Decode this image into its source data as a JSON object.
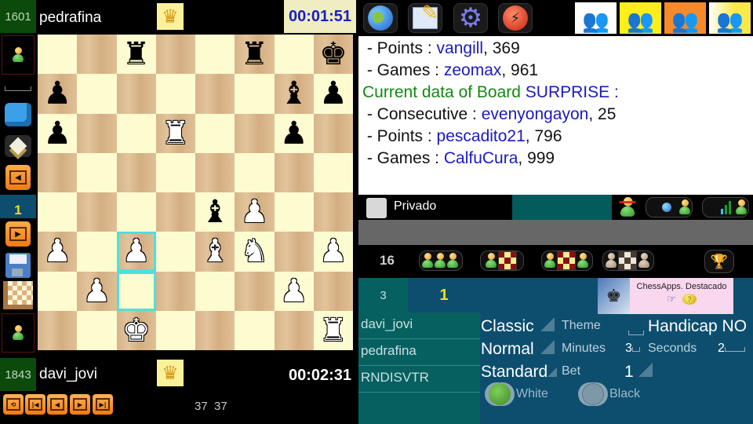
{
  "top_player": {
    "rating": "1601",
    "name": "pedrafina",
    "clock": "00:01:51"
  },
  "bottom_player": {
    "rating": "1843",
    "name": "davi_jovi",
    "clock": "00:02:31"
  },
  "side_toolbar": {
    "page_indicator": "1",
    "icons": [
      "avatar-top",
      "armchair",
      "board-3d",
      "prev-page",
      "page",
      "next-page",
      "save-disk",
      "board-setup",
      "avatar-bottom"
    ]
  },
  "board": {
    "ranks": [
      [
        "",
        "",
        "r",
        "",
        "",
        "r",
        "",
        "k"
      ],
      [
        "p",
        "",
        "",
        "",
        "",
        "",
        "b",
        "p"
      ],
      [
        "p",
        "",
        "",
        "R",
        "",
        "",
        "p",
        ""
      ],
      [
        "",
        "",
        "",
        "",
        "",
        "",
        "",
        ""
      ],
      [
        "",
        "",
        "",
        "",
        "b",
        "P",
        "",
        ""
      ],
      [
        "P",
        "",
        "P",
        "",
        "B",
        "N",
        "",
        "P"
      ],
      [
        "",
        "P",
        "",
        "",
        "",
        "",
        "P",
        ""
      ],
      [
        "",
        "",
        "K",
        "",
        "",
        "",
        "",
        "R"
      ]
    ],
    "highlighted_squares": [
      "c3",
      "c2"
    ]
  },
  "move_nav": {
    "buttons": [
      "flip",
      "first",
      "prev",
      "next",
      "last"
    ],
    "move_counter": "37  37"
  },
  "top_toolbar": {
    "icons": [
      "globe",
      "notepad",
      "settings-gear",
      "lightning"
    ],
    "rooms": [
      {
        "name": "room-white",
        "color": "#ffffff"
      },
      {
        "name": "room-yellow",
        "color": "#ffee1a"
      },
      {
        "name": "room-orange",
        "color": "#f68a2a"
      },
      {
        "name": "room-yellow-white",
        "color": "#fbe94a"
      }
    ]
  },
  "info_panel": {
    "lines": [
      {
        "prefix": " - Points : ",
        "player": "vangill",
        "value": ", 369"
      },
      {
        "prefix": " - Games : ",
        "player": "zeomax",
        "value": ", 961"
      },
      {
        "heading": "Current data of Board ",
        "board": "SURPRISE",
        "suffix": " :"
      },
      {
        "prefix": " - Consecutive : ",
        "player": "evenyongayon",
        "value": ", 25"
      },
      {
        "prefix": " - Points : ",
        "player": "pescadito21",
        "value": ", 796"
      },
      {
        "prefix": " - Games : ",
        "player": "CalfuCura",
        "value": ", 999"
      }
    ]
  },
  "private_row": {
    "label": "Privado",
    "checked": false
  },
  "filter_row": {
    "count": "16"
  },
  "tables": {
    "tab_count": "3",
    "tab_selected": "1",
    "players": [
      "davi_jovi",
      "pedrafina",
      "RNDISVTR"
    ]
  },
  "ad": {
    "text": "ChessApps. Destacado"
  },
  "options": {
    "style": "Classic",
    "theme_label": "Theme",
    "handicap": "Handicap NO",
    "speed": "Normal",
    "minutes_label": "Minutes",
    "minutes": "3",
    "seconds_label": "Seconds",
    "seconds": "2",
    "variant": "Standard",
    "bet_label": "Bet",
    "bet": "1",
    "color_white": "White",
    "color_black": "Black",
    "selected_color": "White"
  }
}
